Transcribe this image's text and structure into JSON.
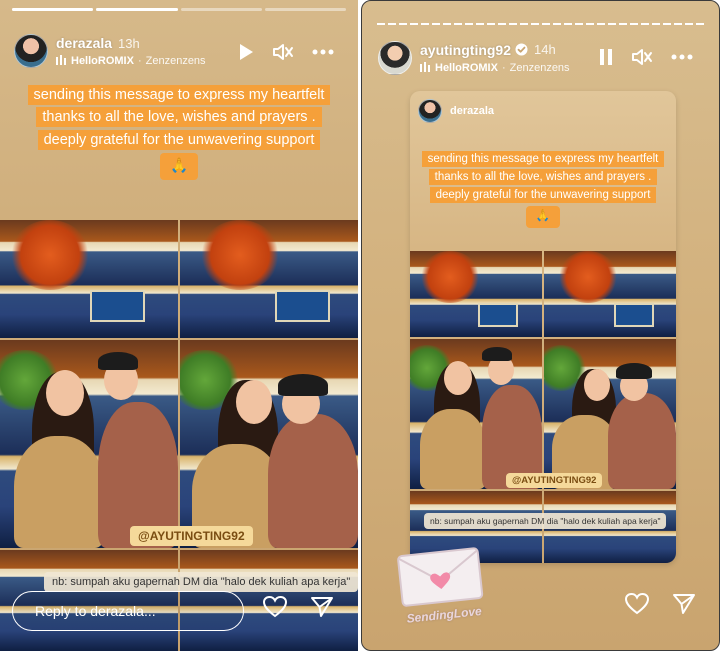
{
  "left_story": {
    "username": "derazala",
    "time": "13h",
    "music_title": "HelloROMIX",
    "music_artist": "Zenzenzens",
    "caption_lines": [
      "sending this message to express my heartfelt",
      "thanks to all the love, wishes and prayers .",
      "deeply grateful for the unwavering support"
    ],
    "caption_emoji": "🙏",
    "tag": "@AYUTINGTING92",
    "note": "nb: sumpah aku gapernah DM dia \"halo dek kuliah apa kerja\"",
    "reply_placeholder": "Reply to derazala...",
    "progress": 0.25
  },
  "right_story": {
    "username": "ayutingting92",
    "verified_icon": "verified-badge-icon",
    "time": "14h",
    "music_title": "HelloROMIX",
    "music_artist": "Zenzenzens",
    "shared_username": "derazala",
    "caption_lines": [
      "sending this message to express my heartfelt",
      "thanks to all the love, wishes and prayers .",
      "deeply grateful for the unwavering support"
    ],
    "caption_emoji": "🙏",
    "tag": "@AYUTINGTING92",
    "note": "nb: sumpah aku gapernah DM dia \"halo dek kuliah apa kerja\"",
    "sticker_text": "SendingLove"
  },
  "colors": {
    "caption_bg": "#f5a03a",
    "story_bg": "#d2b07c"
  }
}
